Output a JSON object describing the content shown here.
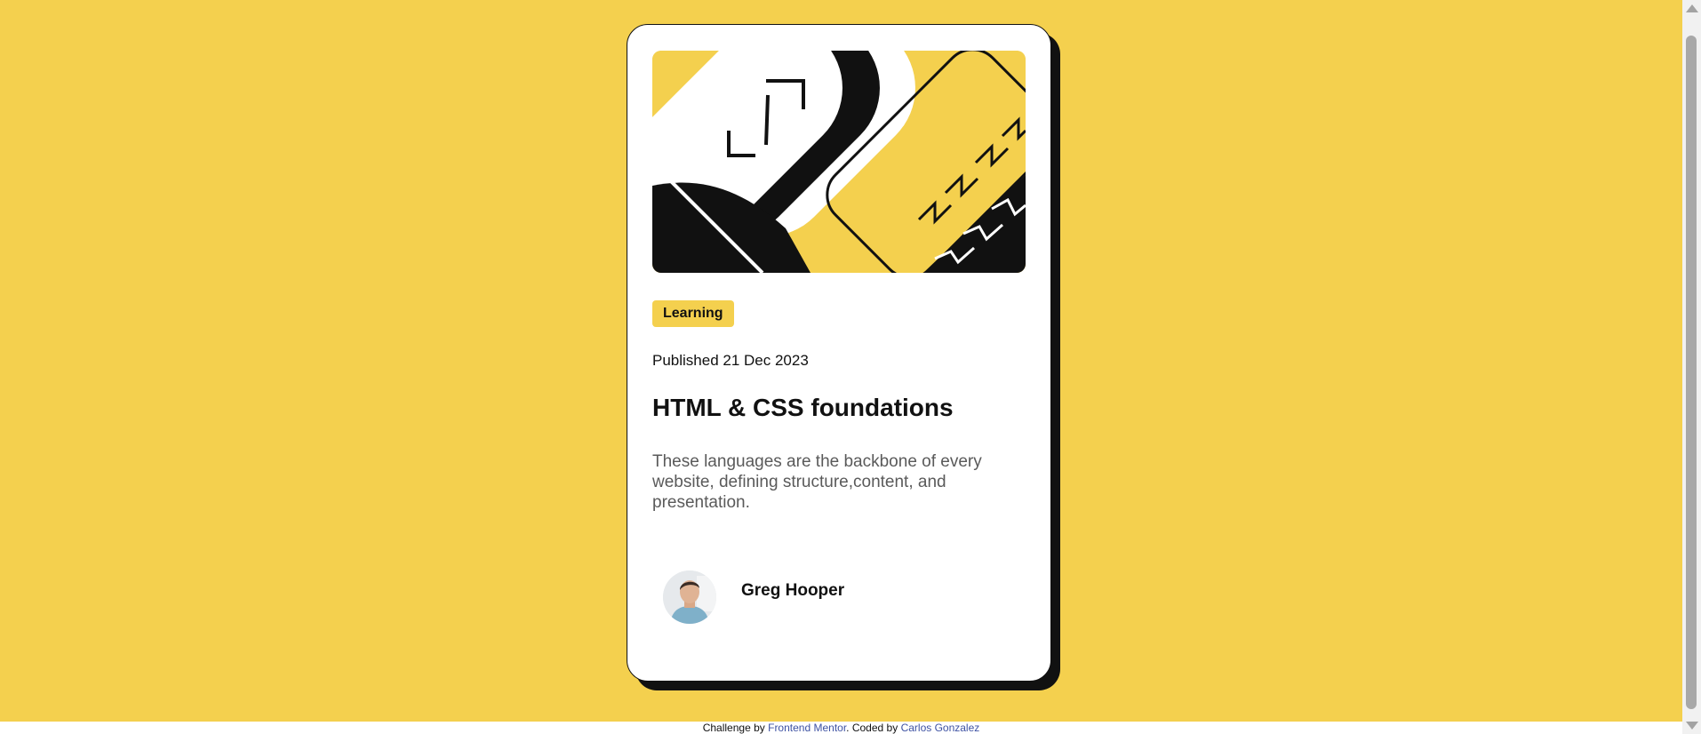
{
  "card": {
    "tag": "Learning",
    "published": "Published 21 Dec 2023",
    "title": "HTML & CSS foundations",
    "description": "These languages are the backbone of every website, defining structure,content, and presentation.",
    "author_name": "Greg Hooper"
  },
  "footer": {
    "challenge_prefix": "Challenge by",
    "challenge_link": "Frontend Mentor",
    "coded_prefix": ". Coded by",
    "coder_link": "Carlos Gonzalez"
  },
  "colors": {
    "background": "#f4d04e",
    "card": "#ffffff",
    "text": "#111111",
    "muted_text": "#5a5a5a",
    "link": "#3e52a3"
  },
  "icons": {
    "hero": "abstract-illustration",
    "avatar": "author-photo"
  }
}
